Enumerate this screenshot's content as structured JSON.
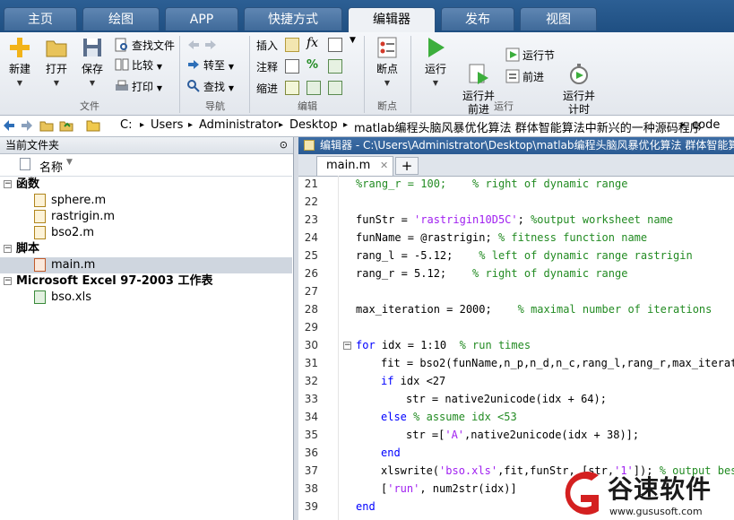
{
  "tabs": [
    {
      "label": "主页",
      "active": false
    },
    {
      "label": "绘图",
      "active": false
    },
    {
      "label": "APP",
      "active": false
    },
    {
      "label": "快捷方式",
      "active": false
    },
    {
      "label": "编辑器",
      "active": true
    },
    {
      "label": "发布",
      "active": false
    },
    {
      "label": "视图",
      "active": false
    }
  ],
  "ribbon": {
    "file_group": {
      "new": "新建",
      "open": "打开",
      "save": "保存",
      "find_files": "查找文件",
      "compare": "比较",
      "print": "打印",
      "label": "文件"
    },
    "nav_group": {
      "goto": "转至",
      "find": "查找",
      "label": "导航"
    },
    "edit_group": {
      "insert": "插入",
      "comment": "注释",
      "indent": "缩进",
      "fx": "fx",
      "percent": "%",
      "label": "编辑"
    },
    "breakpoint_group": {
      "breakpoints": "断点",
      "label": "断点"
    },
    "run_group": {
      "run": "运行",
      "run_advance": "运行并\n前进",
      "run_section": "运行节",
      "advance": "前进",
      "run_time": "运行并\n计时",
      "label": "运行"
    }
  },
  "address": {
    "crumbs": [
      "C:",
      "Users",
      "Administrator",
      "Desktop",
      "matlab编程头脑风暴优化算法 群体智能算法中新兴的一种源码程序",
      "code"
    ]
  },
  "left_panel": {
    "title": "当前文件夹",
    "column": "名称",
    "groups": [
      {
        "label": "函数",
        "files": [
          "sphere.m",
          "rastrigin.m",
          "bso2.m"
        ]
      },
      {
        "label": "脚本",
        "files": [
          "main.m"
        ]
      },
      {
        "label": "Microsoft Excel 97-2003 工作表",
        "files": [
          "bso.xls"
        ]
      }
    ]
  },
  "editor": {
    "title": "编辑器 - C:\\Users\\Administrator\\Desktop\\matlab编程头脑风暴优化算法 群体智能算",
    "tab": "main.m",
    "close_glyph": "✕",
    "add_glyph": "+",
    "lines": [
      {
        "n": "21",
        "indent": 1,
        "parts": [
          [
            "cm",
            "%rang_r = 100;    % right of dynamic range"
          ]
        ]
      },
      {
        "n": "22",
        "indent": 0,
        "parts": []
      },
      {
        "n": "23",
        "indent": 1,
        "parts": [
          [
            "",
            "funStr = "
          ],
          [
            "st",
            "'rastrigin10D5C'"
          ],
          [
            "",
            "; "
          ],
          [
            "cm",
            "%output worksheet name"
          ]
        ]
      },
      {
        "n": "24",
        "indent": 1,
        "parts": [
          [
            "",
            "funName = @rastrigin; "
          ],
          [
            "cm",
            "% fitness function name"
          ]
        ]
      },
      {
        "n": "25",
        "indent": 1,
        "parts": [
          [
            "",
            "rang_l = -5.12;    "
          ],
          [
            "cm",
            "% left of dynamic range rastrigin"
          ]
        ]
      },
      {
        "n": "26",
        "indent": 1,
        "parts": [
          [
            "",
            "rang_r = 5.12;    "
          ],
          [
            "cm",
            "% right of dynamic range"
          ]
        ]
      },
      {
        "n": "27",
        "indent": 0,
        "parts": []
      },
      {
        "n": "28",
        "indent": 1,
        "parts": [
          [
            "",
            "max_iteration = 2000;    "
          ],
          [
            "cm",
            "% maximal number of iterations"
          ]
        ]
      },
      {
        "n": "29",
        "indent": 0,
        "parts": []
      },
      {
        "n": "30",
        "indent": 0,
        "parts": [
          [
            "kw",
            "for"
          ],
          [
            "",
            " idx = 1:10  "
          ],
          [
            "cm",
            "% run times"
          ]
        ]
      },
      {
        "n": "31",
        "indent": 2,
        "parts": [
          [
            "",
            "fit = bso2(funName,n_p,n_d,n_c,rang_l,rang_r,max_iteratic"
          ]
        ]
      },
      {
        "n": "32",
        "indent": 2,
        "parts": [
          [
            "kw",
            "if"
          ],
          [
            "",
            " idx <27"
          ]
        ]
      },
      {
        "n": "33",
        "indent": 3,
        "parts": [
          [
            "",
            "str = native2unicode(idx + 64);"
          ]
        ]
      },
      {
        "n": "34",
        "indent": 2,
        "parts": [
          [
            "kw",
            "else"
          ],
          [
            "",
            " "
          ],
          [
            "cm",
            "% assume idx <53"
          ]
        ]
      },
      {
        "n": "35",
        "indent": 3,
        "parts": [
          [
            "",
            "str =["
          ],
          [
            "st",
            "'A'"
          ],
          [
            "",
            ",native2unicode(idx + 38)];"
          ]
        ]
      },
      {
        "n": "36",
        "indent": 2,
        "parts": [
          [
            "kw",
            "end"
          ]
        ]
      },
      {
        "n": "37",
        "indent": 2,
        "parts": [
          [
            "",
            "xlswrite("
          ],
          [
            "st",
            "'bso.xls'"
          ],
          [
            "",
            ",fit,funStr, [str,"
          ],
          [
            "st",
            "'1'"
          ],
          [
            "",
            "]); "
          ],
          [
            "cm",
            "% output best"
          ]
        ]
      },
      {
        "n": "38",
        "indent": 2,
        "parts": [
          [
            "",
            "["
          ],
          [
            "st",
            "'run'"
          ],
          [
            "",
            ", num2str(idx)]"
          ]
        ]
      },
      {
        "n": "39",
        "indent": 0,
        "parts": [
          [
            "kw",
            "end"
          ]
        ]
      }
    ]
  },
  "watermark": {
    "brand": "谷速软件",
    "url": "www.gususoft.com"
  },
  "colors": {
    "accent": "#2b5b93",
    "comment": "#228b22",
    "keyword": "#0000ff",
    "string": "#a020f0",
    "watermark_red": "#d42020"
  }
}
